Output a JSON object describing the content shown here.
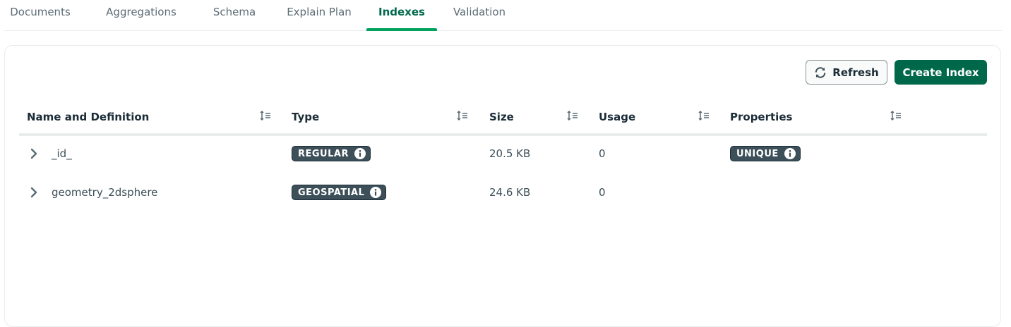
{
  "tabs": [
    {
      "label": "Documents"
    },
    {
      "label": "Aggregations"
    },
    {
      "label": "Schema"
    },
    {
      "label": "Explain Plan"
    },
    {
      "label": "Indexes"
    },
    {
      "label": "Validation"
    }
  ],
  "active_tab": "Indexes",
  "toolbar": {
    "refresh_label": "Refresh",
    "create_label": "Create Index"
  },
  "table": {
    "columns": [
      "Name and Definition",
      "Type",
      "Size",
      "Usage",
      "Properties"
    ],
    "rows": [
      {
        "name": "_id_",
        "type": "REGULAR",
        "size": "20.5 KB",
        "usage": "0",
        "property": "UNIQUE"
      },
      {
        "name": "geometry_2dsphere",
        "type": "GEOSPATIAL",
        "size": "24.6 KB",
        "usage": "0",
        "property": ""
      }
    ]
  },
  "colors": {
    "accent": "#00684a",
    "tab_underline": "#00a35c",
    "badge_bg": "#3d4f58"
  },
  "icons": {
    "refresh": "refresh-icon",
    "sort": "sort-icon",
    "expand": "chevron-right-icon",
    "info": "info-icon"
  }
}
